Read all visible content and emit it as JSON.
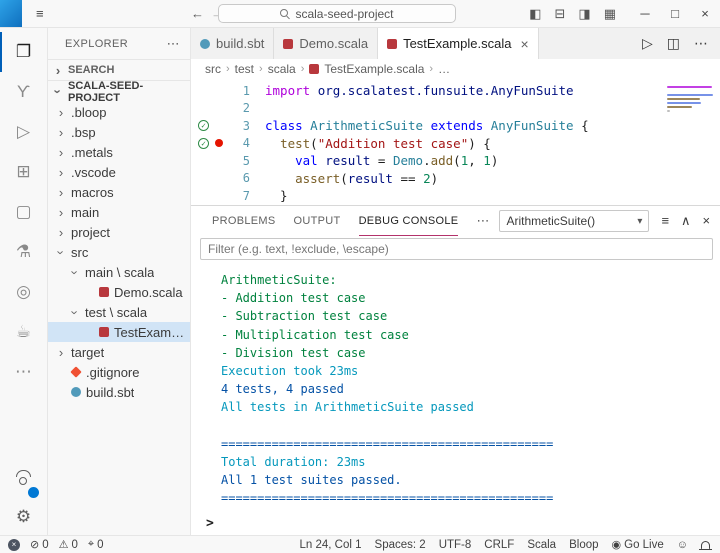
{
  "colors": {
    "accent_blue": "#005fb8",
    "badge_blue": "#0078d4",
    "tree_selection_bg": "#d1e4f6",
    "panel_active_underline": "#b3326b",
    "test_pass_green": "#2e8b46",
    "breakpoint_red": "#e51400",
    "console_green": "#00823e",
    "console_cyan": "#0598bc",
    "console_blue": "#0451a5"
  },
  "icons": {
    "menu": "≡",
    "back": "←",
    "forward": "→",
    "more": "⋯",
    "dropdown_arrow": "▾",
    "close": "×",
    "tree_chevron": "›",
    "breadcrumb_sep": "›",
    "check": "✓",
    "gear": "⚙"
  },
  "titlebar": {
    "search_value": "scala-seed-project",
    "layout_icons": [
      {
        "name": "toggle-sidebar",
        "glyph": "◧"
      },
      {
        "name": "toggle-panel",
        "glyph": "⊟"
      },
      {
        "name": "toggle-secondary-sidebar",
        "glyph": "◨"
      },
      {
        "name": "customize-layout",
        "glyph": "▦"
      }
    ],
    "window_controls": [
      {
        "name": "minimize",
        "glyph": "─"
      },
      {
        "name": "maximize",
        "glyph": "□"
      },
      {
        "name": "close",
        "glyph": "×"
      }
    ]
  },
  "activity_bar": {
    "items": [
      {
        "name": "explorer",
        "glyph": "❐",
        "active": true
      },
      {
        "name": "source-control",
        "glyph": "ϒ"
      },
      {
        "name": "run-debug",
        "glyph": "▷"
      },
      {
        "name": "extensions",
        "glyph": "⊞"
      },
      {
        "name": "remote-explorer",
        "glyph": "▢"
      },
      {
        "name": "test",
        "glyph": "⚗"
      },
      {
        "name": "power",
        "glyph": "◎"
      },
      {
        "name": "metals",
        "glyph": "☕"
      },
      {
        "name": "more-tools",
        "glyph": "⋯"
      }
    ],
    "account_badge": "1"
  },
  "sidebar": {
    "title": "EXPLORER",
    "search_section": "SEARCH",
    "project_name": "SCALA-SEED-PROJECT",
    "tree": [
      {
        "label": ".bloop",
        "depth": 0,
        "kind": "folder",
        "expanded": false
      },
      {
        "label": ".bsp",
        "depth": 0,
        "kind": "folder",
        "expanded": false
      },
      {
        "label": ".metals",
        "depth": 0,
        "kind": "folder",
        "expanded": false
      },
      {
        "label": ".vscode",
        "depth": 0,
        "kind": "folder",
        "expanded": false
      },
      {
        "label": "macros",
        "depth": 0,
        "kind": "folder",
        "expanded": false
      },
      {
        "label": "main",
        "depth": 0,
        "kind": "folder",
        "expanded": false
      },
      {
        "label": "project",
        "depth": 0,
        "kind": "folder",
        "expanded": false
      },
      {
        "label": "src",
        "depth": 0,
        "kind": "folder",
        "expanded": true
      },
      {
        "label": "main \\ scala",
        "depth": 1,
        "kind": "folder",
        "expanded": true
      },
      {
        "label": "Demo.scala",
        "depth": 2,
        "kind": "file",
        "icon": "scala"
      },
      {
        "label": "test \\ scala",
        "depth": 1,
        "kind": "folder",
        "expanded": true
      },
      {
        "label": "TestExample.scala",
        "depth": 2,
        "kind": "file",
        "icon": "scala",
        "selected": true
      },
      {
        "label": "target",
        "depth": 0,
        "kind": "folder",
        "expanded": false
      },
      {
        "label": ".gitignore",
        "depth": 0,
        "kind": "file",
        "icon": "git"
      },
      {
        "label": "build.sbt",
        "depth": 0,
        "kind": "file",
        "icon": "sbt"
      }
    ]
  },
  "editor": {
    "tabs": [
      {
        "label": "build.sbt",
        "icon": "sbt",
        "active": false
      },
      {
        "label": "Demo.scala",
        "icon": "scala",
        "active": false
      },
      {
        "label": "TestExample.scala",
        "icon": "scala",
        "active": true
      }
    ],
    "actions": [
      {
        "name": "run",
        "glyph": "▷"
      },
      {
        "name": "split-editor",
        "glyph": "◫"
      },
      {
        "name": "more-actions",
        "glyph": "⋯"
      }
    ],
    "breadcrumb": [
      "src",
      "test",
      "scala",
      "TestExample.scala",
      "…"
    ],
    "test_pass_lines": [
      3,
      4
    ],
    "breakpoint_lines": [
      4
    ],
    "code_lines": [
      {
        "num": "1",
        "segments": [
          {
            "t": "import ",
            "c": "kw"
          },
          {
            "t": "org.scalatest.funsuite.AnyFunSuite",
            "c": "var"
          }
        ]
      },
      {
        "num": "2",
        "segments": []
      },
      {
        "num": "3",
        "segments": [
          {
            "t": "class ",
            "c": "blue"
          },
          {
            "t": "ArithmeticSuite",
            "c": "type"
          },
          {
            "t": " extends ",
            "c": "blue"
          },
          {
            "t": "AnyFunSuite",
            "c": "type"
          },
          {
            "t": " {",
            "c": "plain"
          }
        ]
      },
      {
        "num": "4",
        "segments": [
          {
            "t": "  ",
            "c": "plain"
          },
          {
            "t": "test",
            "c": "fn"
          },
          {
            "t": "(",
            "c": "plain"
          },
          {
            "t": "\"Addition test case\"",
            "c": "str"
          },
          {
            "t": ") {",
            "c": "plain"
          }
        ]
      },
      {
        "num": "5",
        "segments": [
          {
            "t": "    ",
            "c": "plain"
          },
          {
            "t": "val ",
            "c": "blue"
          },
          {
            "t": "result",
            "c": "var"
          },
          {
            "t": " = ",
            "c": "plain"
          },
          {
            "t": "Demo",
            "c": "type"
          },
          {
            "t": ".",
            "c": "plain"
          },
          {
            "t": "add",
            "c": "fn"
          },
          {
            "t": "(",
            "c": "plain"
          },
          {
            "t": "1",
            "c": "num"
          },
          {
            "t": ", ",
            "c": "plain"
          },
          {
            "t": "1",
            "c": "num"
          },
          {
            "t": ")",
            "c": "plain"
          }
        ]
      },
      {
        "num": "6",
        "segments": [
          {
            "t": "    ",
            "c": "plain"
          },
          {
            "t": "assert",
            "c": "fn"
          },
          {
            "t": "(",
            "c": "plain"
          },
          {
            "t": "result",
            "c": "var"
          },
          {
            "t": " == ",
            "c": "plain"
          },
          {
            "t": "2",
            "c": "num"
          },
          {
            "t": ")",
            "c": "plain"
          }
        ]
      },
      {
        "num": "7",
        "segments": [
          {
            "t": "  }",
            "c": "plain"
          }
        ]
      }
    ]
  },
  "panel": {
    "tabs": [
      {
        "label": "PROBLEMS",
        "active": false
      },
      {
        "label": "OUTPUT",
        "active": false
      },
      {
        "label": "DEBUG CONSOLE",
        "active": true
      }
    ],
    "session_dropdown": "ArithmeticSuite()",
    "actions": [
      {
        "name": "filter",
        "glyph": "≡"
      },
      {
        "name": "maximize-panel",
        "glyph": "∧"
      },
      {
        "name": "close-panel",
        "glyph": "×"
      }
    ],
    "filter_placeholder": "Filter (e.g. text, !exclude, \\escape)",
    "prompt": ">",
    "console": [
      {
        "text": "ArithmeticSuite:",
        "color": "green"
      },
      {
        "text": "- Addition test case",
        "color": "green"
      },
      {
        "text": "- Subtraction test case",
        "color": "green"
      },
      {
        "text": "- Multiplication test case",
        "color": "green"
      },
      {
        "text": "- Division test case",
        "color": "green"
      },
      {
        "text": "Execution took 23ms",
        "color": "cyan"
      },
      {
        "text": "4 tests, 4 passed",
        "color": "blue"
      },
      {
        "text": "All tests in ArithmeticSuite passed",
        "color": "cyan"
      },
      {
        "text": "",
        "color": "plain"
      },
      {
        "text": "==============================================",
        "color": "blue"
      },
      {
        "text": "Total duration: 23ms",
        "color": "cyan"
      },
      {
        "text": "All 1 test suites passed.",
        "color": "blue"
      },
      {
        "text": "==============================================",
        "color": "blue"
      }
    ]
  },
  "status_bar": {
    "left": [
      {
        "name": "remote-indicator",
        "glyph": "×",
        "style": "dot"
      },
      {
        "name": "errors",
        "glyph": "⊘",
        "value": "0"
      },
      {
        "name": "warnings",
        "glyph": "⚠",
        "value": "0"
      },
      {
        "name": "ports-forwarded",
        "glyph": "⌖",
        "value": "0"
      }
    ],
    "right": [
      {
        "name": "cursor-position",
        "label": "Ln 24, Col 1"
      },
      {
        "name": "indentation",
        "label": "Spaces: 2"
      },
      {
        "name": "encoding",
        "label": "UTF-8"
      },
      {
        "name": "end-of-line",
        "label": "CRLF"
      },
      {
        "name": "language-mode",
        "label": "Scala"
      },
      {
        "name": "bloop",
        "label": "Bloop"
      },
      {
        "name": "go-live",
        "label": "Go Live",
        "glyph": "◉"
      },
      {
        "name": "feedback",
        "glyph": "☺"
      },
      {
        "name": "notifications",
        "style": "bell"
      }
    ]
  }
}
